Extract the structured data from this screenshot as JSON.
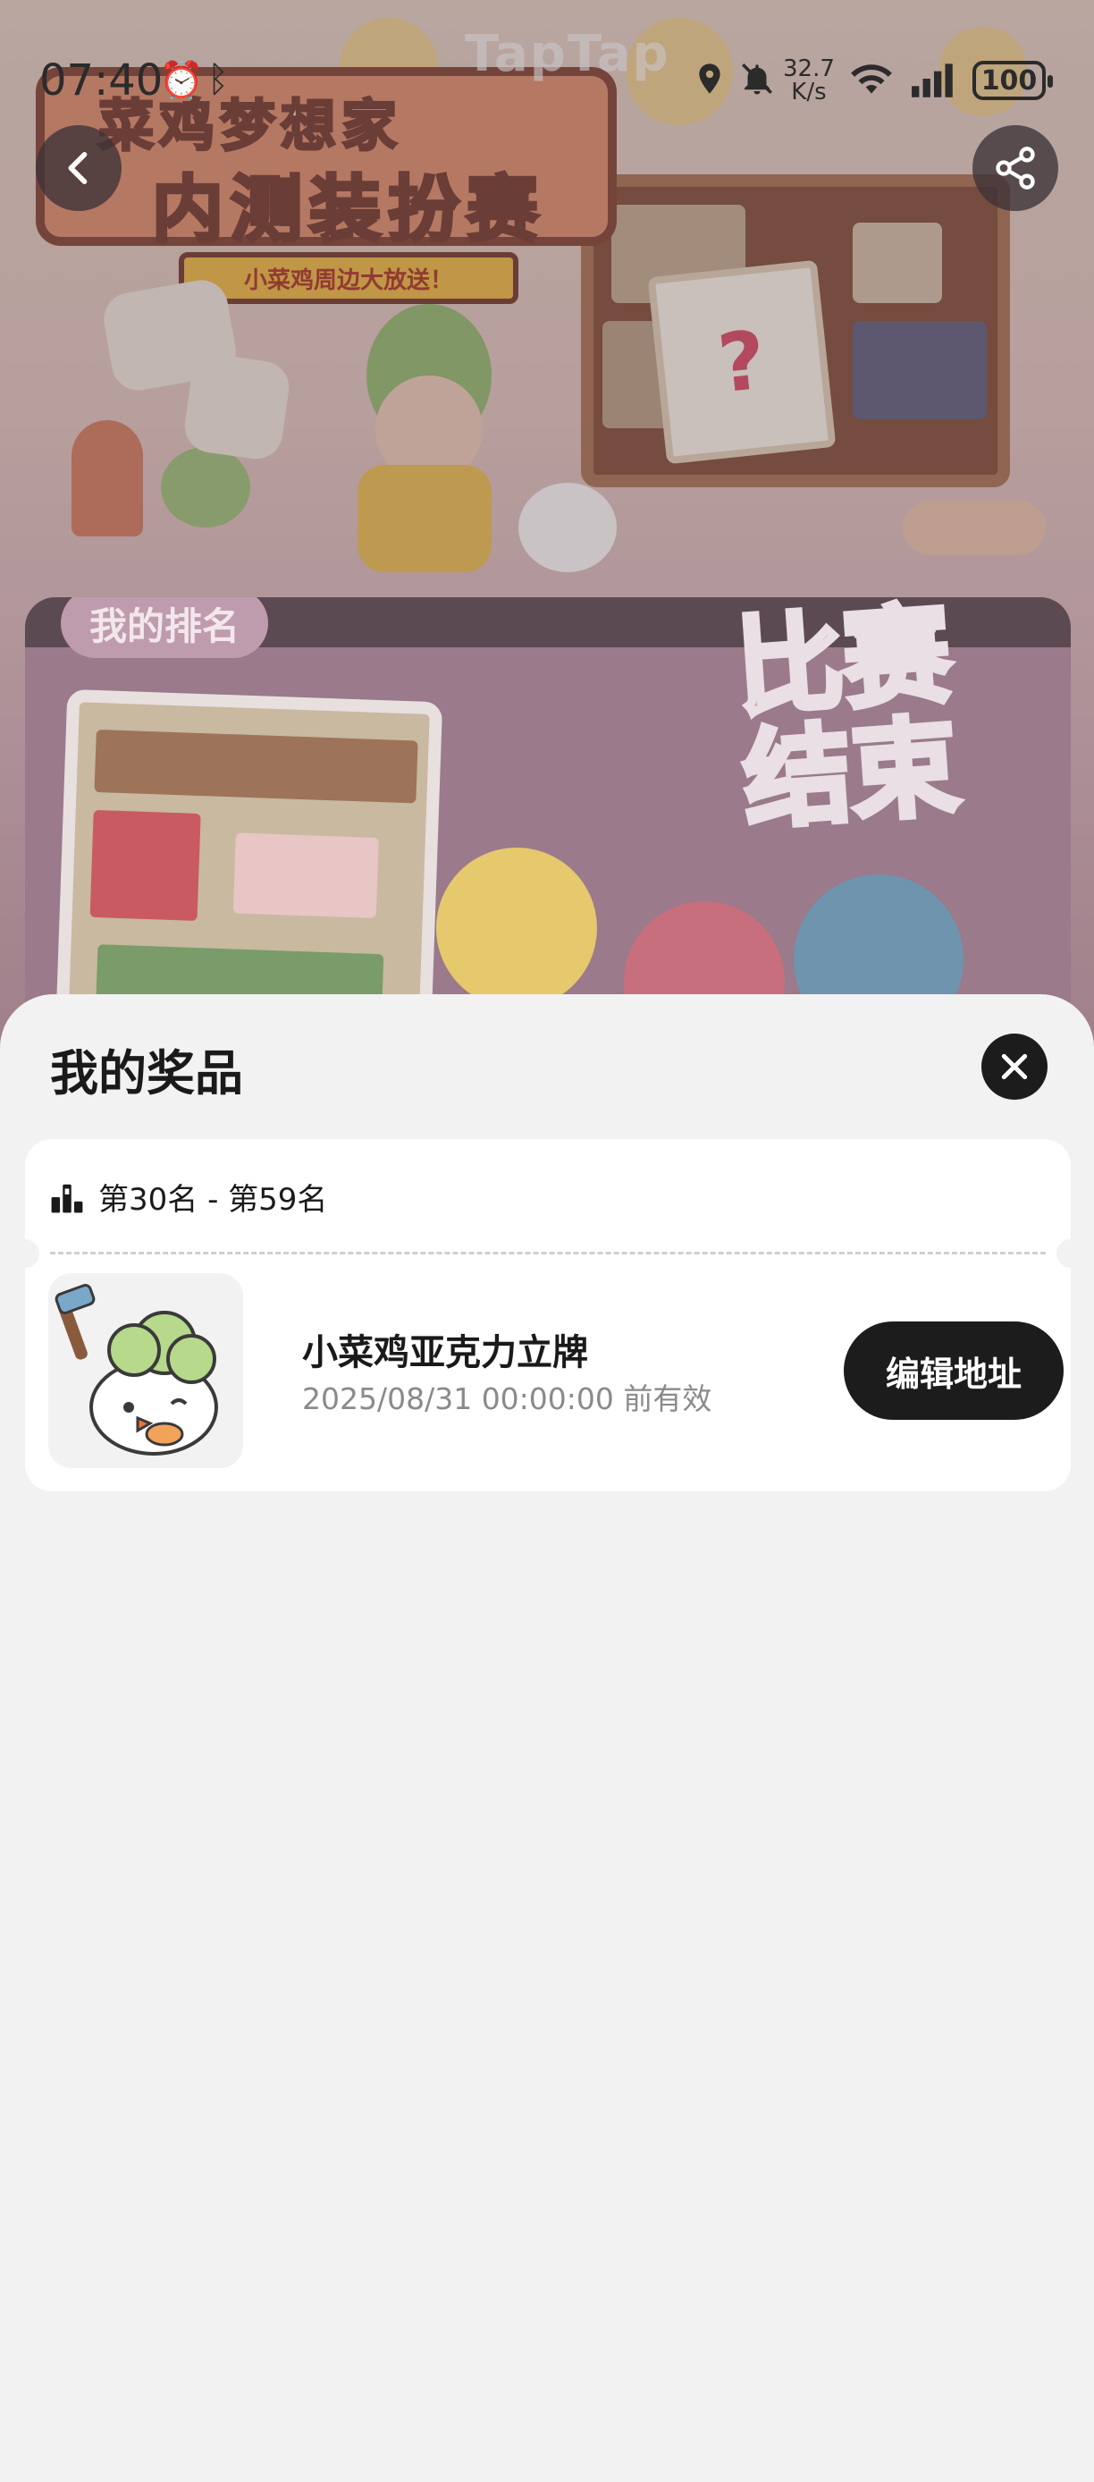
{
  "status_bar": {
    "time": "07:40",
    "network_speed_value": "32.7",
    "network_speed_unit": "K/s",
    "battery": "100"
  },
  "banner": {
    "logo_text": "TapTap",
    "title_line1": "菜鸡梦想家",
    "title_line2": "内测装扮赛",
    "ribbon_text": "小菜鸡周边大放送！",
    "rank_tag": "我的排名",
    "ended_line1": "比赛",
    "ended_line2": "结束",
    "no1_text": "?"
  },
  "sheet": {
    "title": "我的奖品",
    "rank_range": "第30名 - 第59名",
    "prize_name": "小菜鸡亚克力立牌",
    "prize_expire": "2025/08/31 00:00:00 前有效",
    "edit_button_label": "编辑地址"
  },
  "colors": {
    "sheet_bg": "#f2f2f2",
    "card_bg": "#ffffff",
    "button_dark": "#1c1c1c"
  }
}
